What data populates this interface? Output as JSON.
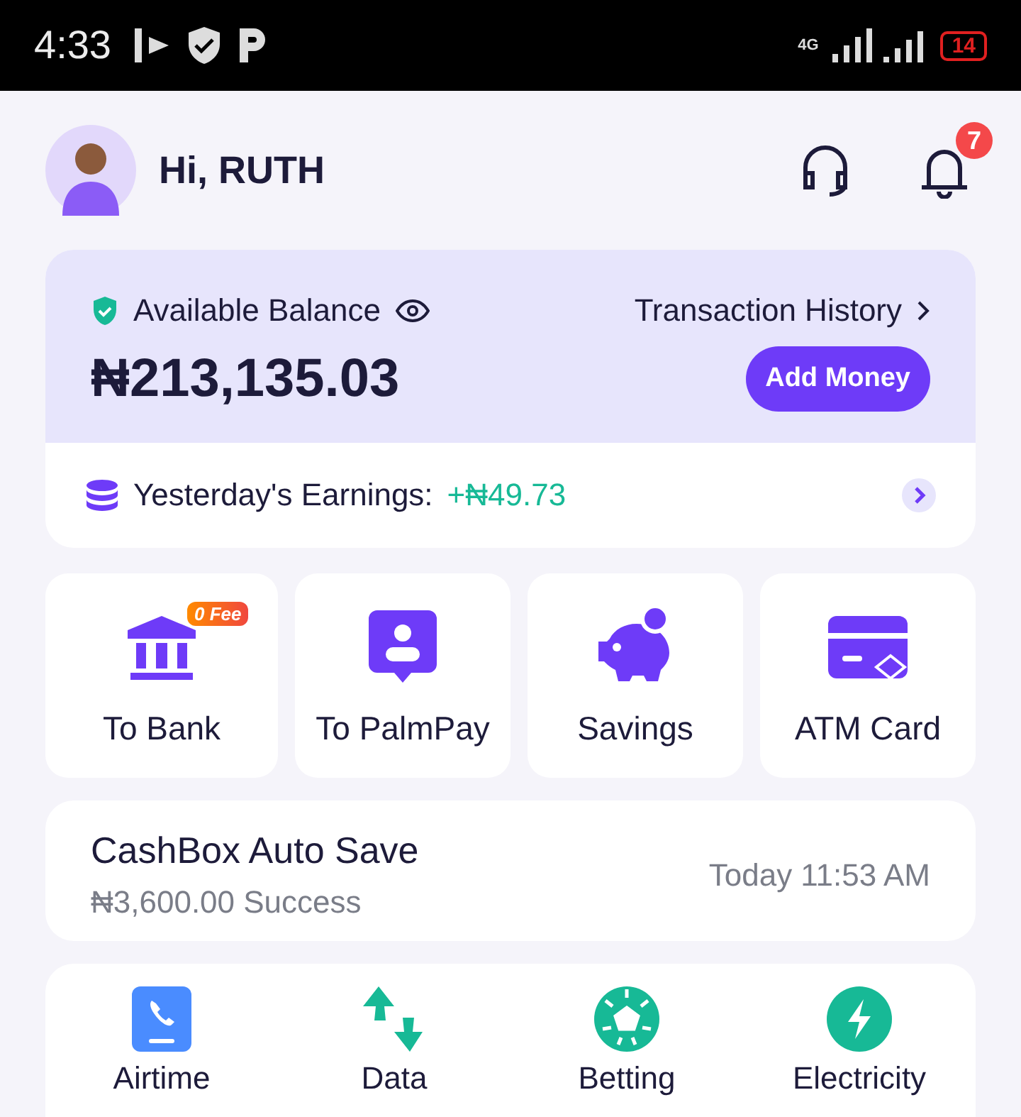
{
  "status_bar": {
    "time": "4:33",
    "network": "4G",
    "battery": "14"
  },
  "header": {
    "greeting": "Hi, RUTH",
    "notifications": "7"
  },
  "balance": {
    "label": "Available Balance",
    "history_link": "Transaction History",
    "amount": "₦213,135.03",
    "add_button": "Add Money",
    "earnings_label": "Yesterday's Earnings:",
    "earnings_value": "+₦49.73"
  },
  "quick_actions": [
    {
      "kind": "bank",
      "label": "To Bank",
      "badge": "0 Fee"
    },
    {
      "kind": "palmpay",
      "label": "To PalmPay"
    },
    {
      "kind": "savings",
      "label": "Savings"
    },
    {
      "kind": "card",
      "label": "ATM Card"
    }
  ],
  "cashbox": {
    "title": "CashBox Auto Save",
    "detail": "₦3,600.00 Success",
    "time": "Today 11:53 AM"
  },
  "services": [
    {
      "kind": "airtime",
      "label": "Airtime"
    },
    {
      "kind": "data",
      "label": "Data"
    },
    {
      "kind": "betting",
      "label": "Betting"
    },
    {
      "kind": "electricity",
      "label": "Electricity"
    }
  ]
}
